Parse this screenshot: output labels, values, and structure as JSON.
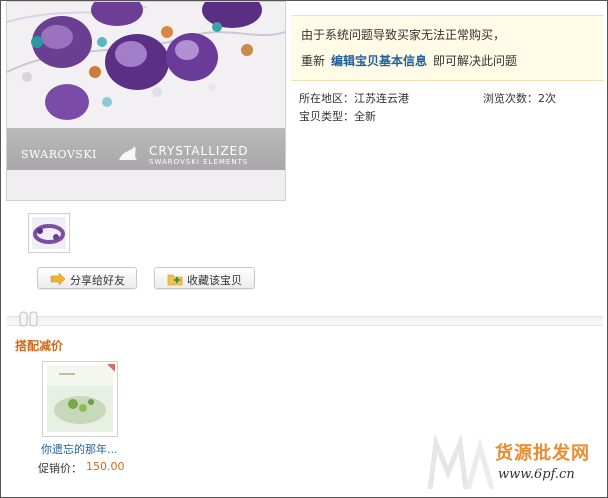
{
  "product_image": {
    "brand_left": "SWAROVSKI",
    "brand_right_line1": "CRYSTALLIZED",
    "brand_right_line2": "SWAROVSKI ELEMENTS"
  },
  "notice": {
    "line1": "由于系统问题导致买家无法正常购买，",
    "prefix": "重新",
    "link": "编辑宝贝基本信息",
    "suffix": "即可解决此问题"
  },
  "info": {
    "location": "所在地区：江苏连云港",
    "views": "浏览次数：2次",
    "item_type": "宝贝类型：全新"
  },
  "buttons": {
    "share": "分享给好友",
    "favorite": "收藏该宝贝"
  },
  "deal_section": {
    "title": "搭配减价",
    "item_name": "你遗忘的那年...",
    "price_label": "促销价：",
    "price": "150.00"
  },
  "watermark": {
    "text": "货源批发网",
    "url": "www.6pf.cn"
  },
  "colors": {
    "link": "#1f5f9e",
    "accent": "#d2691e",
    "notice_bg": "#fffbe7"
  }
}
